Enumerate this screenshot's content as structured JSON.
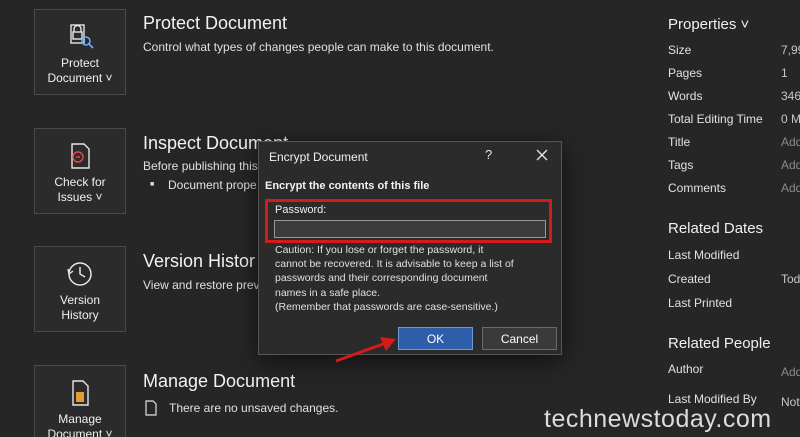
{
  "protect": {
    "tile_label_1": "Protect",
    "tile_label_2": "Document ˅",
    "title": "Protect Document",
    "desc": "Control what types of changes people can make to this document."
  },
  "inspect": {
    "tile_label_1": "Check for",
    "tile_label_2": "Issues ˅",
    "title": "Inspect Document",
    "desc": "Before publishing this",
    "bullet": "Document prope"
  },
  "version": {
    "tile_label_1": "Version",
    "tile_label_2": "History",
    "title": "Version Histor",
    "desc": "View and restore previ"
  },
  "manage": {
    "tile_label_1": "Manage",
    "tile_label_2": "Document ˅",
    "title": "Manage Document",
    "desc": "There are no unsaved changes."
  },
  "properties": {
    "heading": "Properties ˅",
    "rows": [
      {
        "label": "Size",
        "value": "7,99"
      },
      {
        "label": "Pages",
        "value": "1"
      },
      {
        "label": "Words",
        "value": "346"
      },
      {
        "label": "Total Editing Time",
        "value": "0 M"
      },
      {
        "label": "Title",
        "value": "Add"
      },
      {
        "label": "Tags",
        "value": "Add"
      },
      {
        "label": "Comments",
        "value": "Add"
      }
    ],
    "related_dates": {
      "heading": "Related Dates",
      "rows": [
        {
          "label": "Last Modified",
          "value": ""
        },
        {
          "label": "Created",
          "value": "Tod"
        },
        {
          "label": "Last Printed",
          "value": ""
        }
      ]
    },
    "related_people": {
      "heading": "Related People",
      "rows": [
        {
          "label": "Author",
          "value": "Add"
        },
        {
          "label": "Last Modified By",
          "value": "Not"
        }
      ]
    }
  },
  "dialog": {
    "title": "Encrypt Document",
    "help": "?",
    "heading": "Encrypt the contents of this file",
    "password_label": "Password:",
    "password_value": "",
    "caution_lines": [
      "Caution: If you lose or forget the password, it",
      "cannot be recovered. It is advisable to keep a list of",
      "passwords and their corresponding document",
      "names in a safe place.",
      "(Remember that passwords are case-sensitive.)"
    ],
    "ok_label": "OK",
    "cancel_label": "Cancel"
  },
  "watermark": "technewstoday.com",
  "colors": {
    "background": "#262626",
    "accent_button": "#2e5eaa",
    "highlight": "#d41b1b"
  }
}
